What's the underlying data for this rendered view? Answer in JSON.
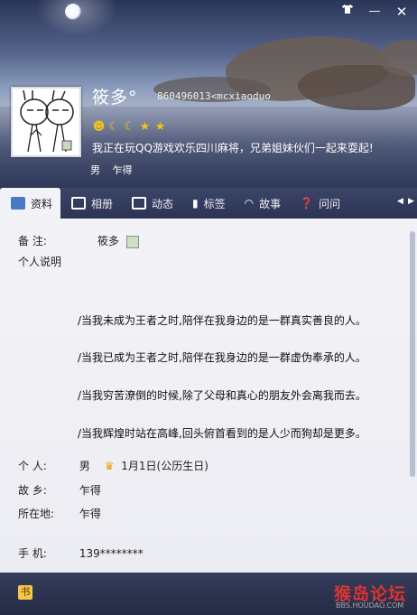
{
  "window": {
    "controls": {
      "skin_icon": "shirt-icon",
      "minimize": "—",
      "close": "✕"
    }
  },
  "profile": {
    "nickname": "筱多°",
    "qq": "860496013<mcxiaoduo",
    "level_icons": [
      "sun-icon",
      "moon-icon",
      "moon-icon",
      "star-icon",
      "star-icon"
    ],
    "signature": "我正在玩QQ游戏欢乐四川麻将，兄弟姐妹伙们一起来耍起!",
    "gender": "男",
    "location": "乍得"
  },
  "tabs": [
    {
      "label": "资料",
      "icon": "card-icon"
    },
    {
      "label": "相册",
      "icon": "photo-icon"
    },
    {
      "label": "动态",
      "icon": "list-icon"
    },
    {
      "label": "标签",
      "icon": "bookmark-icon"
    },
    {
      "label": "故事",
      "icon": "wave-icon"
    },
    {
      "label": "问问",
      "icon": "question-icon"
    }
  ],
  "details": {
    "remark_label": "备  注:",
    "remark_value": "筱多",
    "personal_desc_label": "个人说明",
    "desc_lines": [
      "/当我未成为王者之时,陪伴在我身边的是一群真实善良的人。",
      "/当我已成为王者之时,陪伴在我身边的是一群虚伪奉承的人。",
      "/当我穷苦潦倒的时候,除了父母和真心的朋友外会离我而去。",
      "/当我辉煌时站在高峰,回头俯首看到的是人少而狗却是更多。"
    ],
    "personal_label": "个  人:",
    "personal_gender": "男",
    "birthday": "1月1日(公历生日)",
    "hometown_label": "故  乡:",
    "hometown": "乍得",
    "location_label": "所在地:",
    "location": "乍得",
    "phone_label": "手  机:",
    "phone": "139********"
  },
  "bottom": {
    "app_icon": "书",
    "watermark": "猴岛论坛",
    "watermark_url": "BBS.HOUDAO.COM"
  },
  "colors": {
    "accent": "#4978c5",
    "header_dark": "#2a3658",
    "tab_bar": "#3b4569"
  }
}
